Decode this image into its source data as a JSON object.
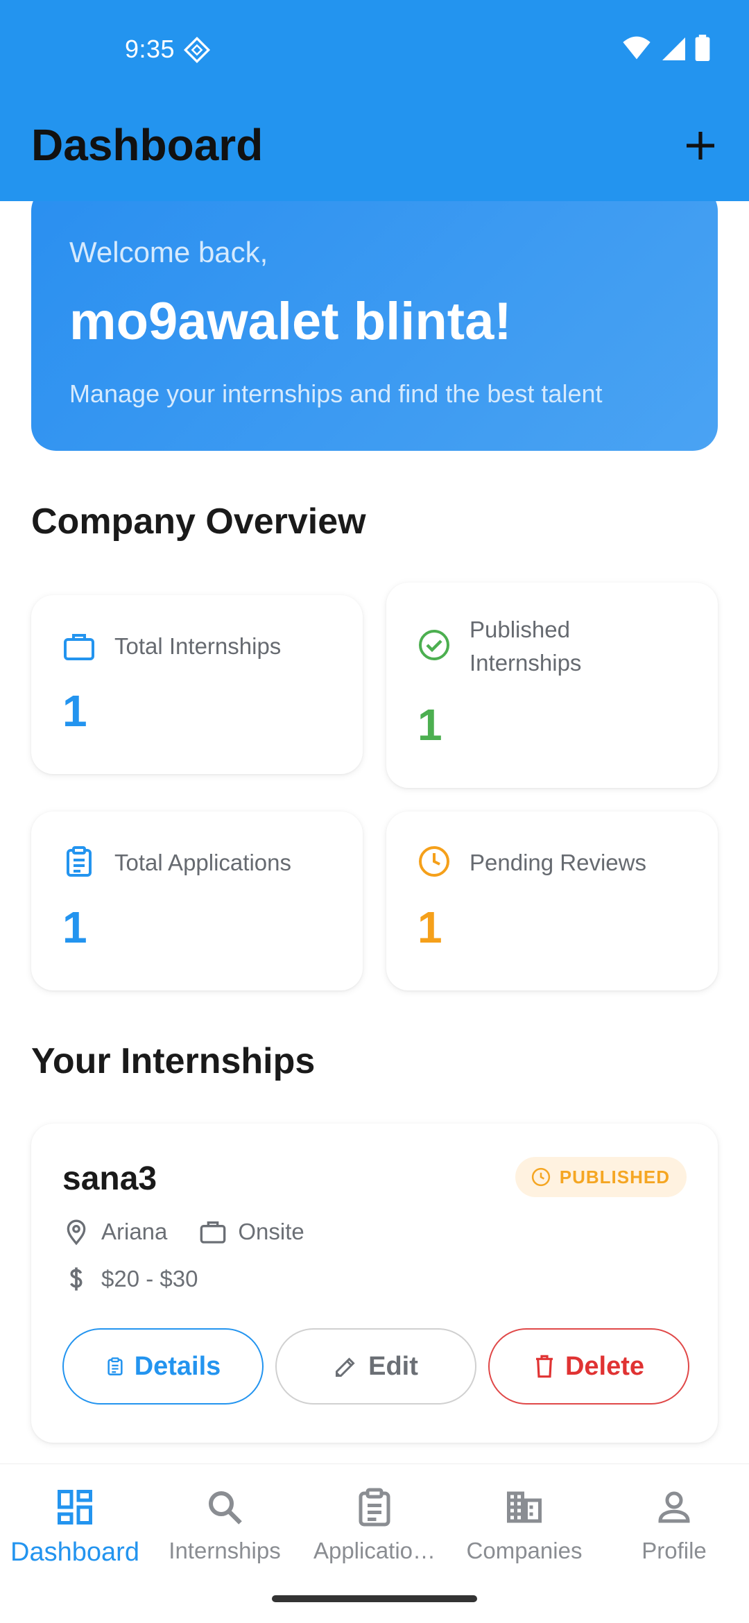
{
  "status_bar": {
    "time": "9:35"
  },
  "app_bar": {
    "title": "Dashboard",
    "add_icon": "plus-icon"
  },
  "welcome": {
    "greeting": "Welcome back,",
    "name": "mo9awalet blinta!",
    "subtitle": "Manage your internships and find the best talent"
  },
  "overview": {
    "title": "Company Overview",
    "stats": [
      {
        "label": "Total Internships",
        "value": "1",
        "icon": "briefcase-icon",
        "color": "#2394ef"
      },
      {
        "label_line1": "Published",
        "label_line2": "Internships",
        "value": "1",
        "icon": "check-circle-icon",
        "color": "#4caf50"
      },
      {
        "label": "Total Applications",
        "value": "1",
        "icon": "clipboard-icon",
        "color": "#2394ef"
      },
      {
        "label": "Pending Reviews",
        "value": "1",
        "icon": "clock-icon",
        "color": "#f5a01a"
      }
    ]
  },
  "internships": {
    "title": "Your Internships",
    "items": [
      {
        "title": "sana3",
        "status": "PUBLISHED",
        "location": "Ariana",
        "work_type": "Onsite",
        "salary": "$20 - $30",
        "details_label": "Details",
        "edit_label": "Edit",
        "delete_label": "Delete"
      }
    ]
  },
  "bottom_nav": {
    "items": [
      {
        "label": "Dashboard",
        "icon": "dashboard-icon",
        "active": true
      },
      {
        "label": "Internships",
        "icon": "search-icon"
      },
      {
        "label": "Applicatio…",
        "icon": "clipboard-icon"
      },
      {
        "label": "Companies",
        "icon": "building-icon"
      },
      {
        "label": "Profile",
        "icon": "person-icon"
      }
    ]
  },
  "colors": {
    "primary": "#2394ef",
    "success": "#4caf50",
    "warning": "#f5a01a",
    "danger": "#e03333"
  }
}
